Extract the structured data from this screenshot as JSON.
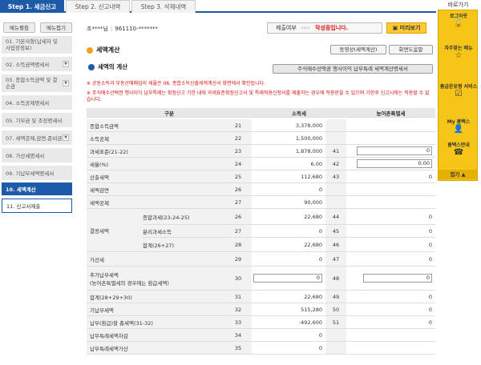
{
  "top_tabs": [
    "Step 1. 세금신고",
    "Step 2. 신고내역",
    "Step 3. 삭제내역"
  ],
  "sidebar": {
    "show_label": "메뉴펼침",
    "hide_label": "메뉴접기",
    "items": [
      "01. 기본사항(납세자 및 사업장정보)",
      "02. 소득금액명세서",
      "03. 종합소득금액 및 결손금",
      "04. 소득공제명세서",
      "05. 기부금 및 조정명세서",
      "07. 세액공제,감면,준비금",
      "08. 가산세명세서",
      "09. 기납부세액명세서",
      "10. 세액계산",
      "11. 신고서제출"
    ]
  },
  "header": {
    "user": "조****님",
    "id": "961110-*******",
    "status_label": "제출여부",
    "arrows": "››››",
    "status_value": "작성중입니다.",
    "preview": "미리보기"
  },
  "section": {
    "title": "세액계산",
    "btn_video": "동영상(세액계산)",
    "btn_help": "화면도움말",
    "subtitle": "세액의 계산",
    "btn_stock": "주식매수선택권 행사이익 납부특례 세액계산명세서"
  },
  "notes": [
    "※ 공동소득과 부동산매매업의 세율은 08. 종합소득산출세액계산서 화면에서 확인됩니다.",
    "※ 주식매수선택권 행사이익 납부특례는 확정신고 기한 내에 과세표준확정신고서 및 특례적용신청서를 제출하는 경우에 적용받을 수 있으며 기한후 신고시에는 적용할 수 없습니다."
  ],
  "table": {
    "headers": [
      "구분",
      "소득세",
      "농어촌특별세"
    ],
    "rows": [
      {
        "label": "종합소득금액",
        "n1": "21",
        "v1": "3,378,000",
        "n2": "",
        "v2": ""
      },
      {
        "label": "소득공제",
        "n1": "22",
        "v1": "1,500,000",
        "n2": "",
        "v2": ""
      },
      {
        "label": "과세표준(21-22)",
        "n1": "23",
        "v1": "1,878,000",
        "n2": "41",
        "v2": "0"
      },
      {
        "label": "세율(%)",
        "n1": "24",
        "v1": "6.00",
        "n2": "42",
        "v2": "0.00"
      },
      {
        "label": "산출세액",
        "n1": "25",
        "v1": "112,680",
        "n2": "43",
        "v2": "0"
      },
      {
        "label": "세액감면",
        "n1": "26",
        "v1": "0",
        "n2": "",
        "v2": ""
      },
      {
        "label": "세액공제",
        "n1": "27",
        "v1": "90,000",
        "n2": "",
        "v2": ""
      },
      {
        "label": "종합과세(23-24-25)",
        "n1": "26",
        "v1": "22,680",
        "n2": "44",
        "v2": "0"
      },
      {
        "label": "분리과세소득",
        "n1": "27",
        "v1": "0",
        "n2": "45",
        "v2": "0"
      },
      {
        "label": "합계(26+27)",
        "n1": "28",
        "v1": "22,680",
        "n2": "46",
        "v2": "0"
      },
      {
        "label": "가산세",
        "n1": "29",
        "v1": "0",
        "n2": "47",
        "v2": "0"
      },
      {
        "label": "추가납부세액",
        "label2": "(농어촌특별세의 경우에는 환급세액)",
        "n1": "30",
        "v1": "0",
        "n2": "48",
        "v2": "0"
      },
      {
        "label": "합계(28+29+30)",
        "n1": "31",
        "v1": "22,680",
        "n2": "49",
        "v2": "0"
      },
      {
        "label": "기납부세액",
        "n1": "32",
        "v1": "515,280",
        "n2": "50",
        "v2": "0"
      },
      {
        "label": "납부(환급)할 총세액(31-32)",
        "n1": "33",
        "v1": "-492,600",
        "n2": "51",
        "v2": "0"
      },
      {
        "label": "납부특례세액차감",
        "n1": "34",
        "v1": "0",
        "n2": "",
        "v2": ""
      },
      {
        "label": "납부특례세액가산",
        "n1": "35",
        "v1": "0",
        "n2": "",
        "v2": ""
      }
    ],
    "merged_label": "결정세액"
  },
  "right_panel": {
    "title": "바로가기",
    "items": [
      {
        "label": "로그아웃",
        "icon": "lock-icon"
      },
      {
        "label": "자주찾는 메뉴",
        "icon": "star-icon"
      },
      {
        "label": "홈급운유형 서비스",
        "icon": "checklist-icon"
      },
      {
        "label": "My 홈택스",
        "icon": "person-icon"
      },
      {
        "label": "홈택스안내",
        "icon": "info-icon"
      }
    ],
    "close": "접기"
  }
}
